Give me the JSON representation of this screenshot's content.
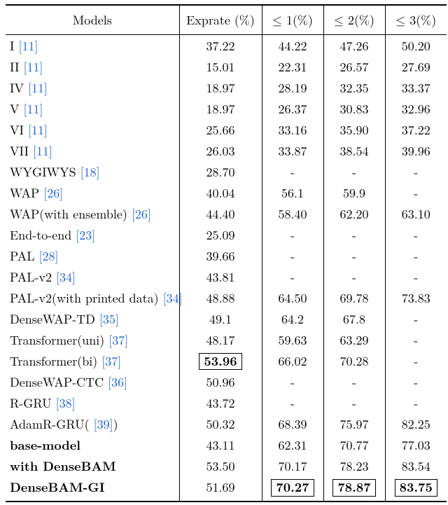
{
  "chart_data": {
    "type": "table",
    "title": "",
    "columns": [
      "Models",
      "Exprate (%)",
      "≤ 1(%)",
      "≤ 2(%)",
      "≤ 3(%)"
    ],
    "rows": [
      {
        "model": "I",
        "cite": "[11]",
        "exprate": "37.22",
        "le1": "44.22",
        "le2": "47.26",
        "le3": "50.20"
      },
      {
        "model": "II",
        "cite": "[11]",
        "exprate": "15.01",
        "le1": "22.31",
        "le2": "26.57",
        "le3": "27.69"
      },
      {
        "model": "IV",
        "cite": "[11]",
        "exprate": "18.97",
        "le1": "28.19",
        "le2": "32.35",
        "le3": "33.37"
      },
      {
        "model": "V",
        "cite": "[11]",
        "exprate": "18.97",
        "le1": "26.37",
        "le2": "30.83",
        "le3": "32.96"
      },
      {
        "model": "VI",
        "cite": "[11]",
        "exprate": "25.66",
        "le1": "33.16",
        "le2": "35.90",
        "le3": "37.22"
      },
      {
        "model": "VII",
        "cite": "[11]",
        "exprate": "26.03",
        "le1": "33.87",
        "le2": "38.54",
        "le3": "39.96"
      },
      {
        "model": "WYGIWYS",
        "cite": "[18]",
        "exprate": "28.70",
        "le1": "-",
        "le2": "-",
        "le3": "-"
      },
      {
        "model": "WAP",
        "cite": "[26]",
        "exprate": "40.04",
        "le1": "56.1",
        "le2": "59.9",
        "le3": "-"
      },
      {
        "model": "WAP(with ensemble)",
        "cite": "[26]",
        "exprate": "44.40",
        "le1": "58.40",
        "le2": "62.20",
        "le3": "63.10"
      },
      {
        "model": "End-to-end",
        "cite": "[23]",
        "exprate": "25.09",
        "le1": "-",
        "le2": "-",
        "le3": "-"
      },
      {
        "model": "PAL",
        "cite": "[28]",
        "exprate": "39.66",
        "le1": "-",
        "le2": "-",
        "le3": "-"
      },
      {
        "model": "PAL-v2",
        "cite": "[34]",
        "exprate": "43.81",
        "le1": "-",
        "le2": "-",
        "le3": "-"
      },
      {
        "model": "PAL-v2(with printed data)",
        "cite": "[34]",
        "exprate": "48.88",
        "le1": "64.50",
        "le2": "69.78",
        "le3": "73.83"
      },
      {
        "model": "DenseWAP-TD",
        "cite": "[35]",
        "exprate": "49.1",
        "le1": "64.2",
        "le2": "67.8",
        "le3": "-"
      },
      {
        "model": "Transformer(uni)",
        "cite": "[37]",
        "exprate": "48.17",
        "le1": "59.63",
        "le2": "63.29",
        "le3": "-"
      },
      {
        "model": "Transformer(bi)",
        "cite": "[37]",
        "exprate": "53.96",
        "le1": "66.02",
        "le2": "70.28",
        "le3": "-",
        "box_exprate": true
      },
      {
        "model": "DenseWAP-CTC",
        "cite": "[36]",
        "exprate": "50.96",
        "le1": "-",
        "le2": "-",
        "le3": "-"
      },
      {
        "model": "R-GRU",
        "cite": "[38]",
        "exprate": "43.72",
        "le1": "-",
        "le2": "-",
        "le3": "-"
      },
      {
        "model": "AdamR-GRU(",
        "cite": "[39]",
        "cite_suffix": ")",
        "exprate": "50.32",
        "le1": "68.39",
        "le2": "75.97",
        "le3": "82.25"
      },
      {
        "model": "base-model",
        "bold_model": true,
        "exprate": "43.11",
        "le1": "62.31",
        "le2": "70.77",
        "le3": "77.03"
      },
      {
        "model": "with DenseBAM",
        "bold_model": true,
        "exprate": "53.50",
        "le1": "70.17",
        "le2": "78.23",
        "le3": "83.54"
      },
      {
        "model": "DenseBAM-GI",
        "bold_model": true,
        "exprate": "51.69",
        "le1": "70.27",
        "le2": "78.87",
        "le3": "83.75",
        "box_le1": true,
        "box_le2": true,
        "box_le3": true
      }
    ]
  },
  "header": {
    "models": "Models",
    "exprate": "Exprate (%)",
    "le1_pre": "≤ ",
    "le1_post": "1(%)",
    "le2_pre": "≤ ",
    "le2_post": "2(%)",
    "le3_pre": "≤ ",
    "le3_post": "3(%)"
  }
}
